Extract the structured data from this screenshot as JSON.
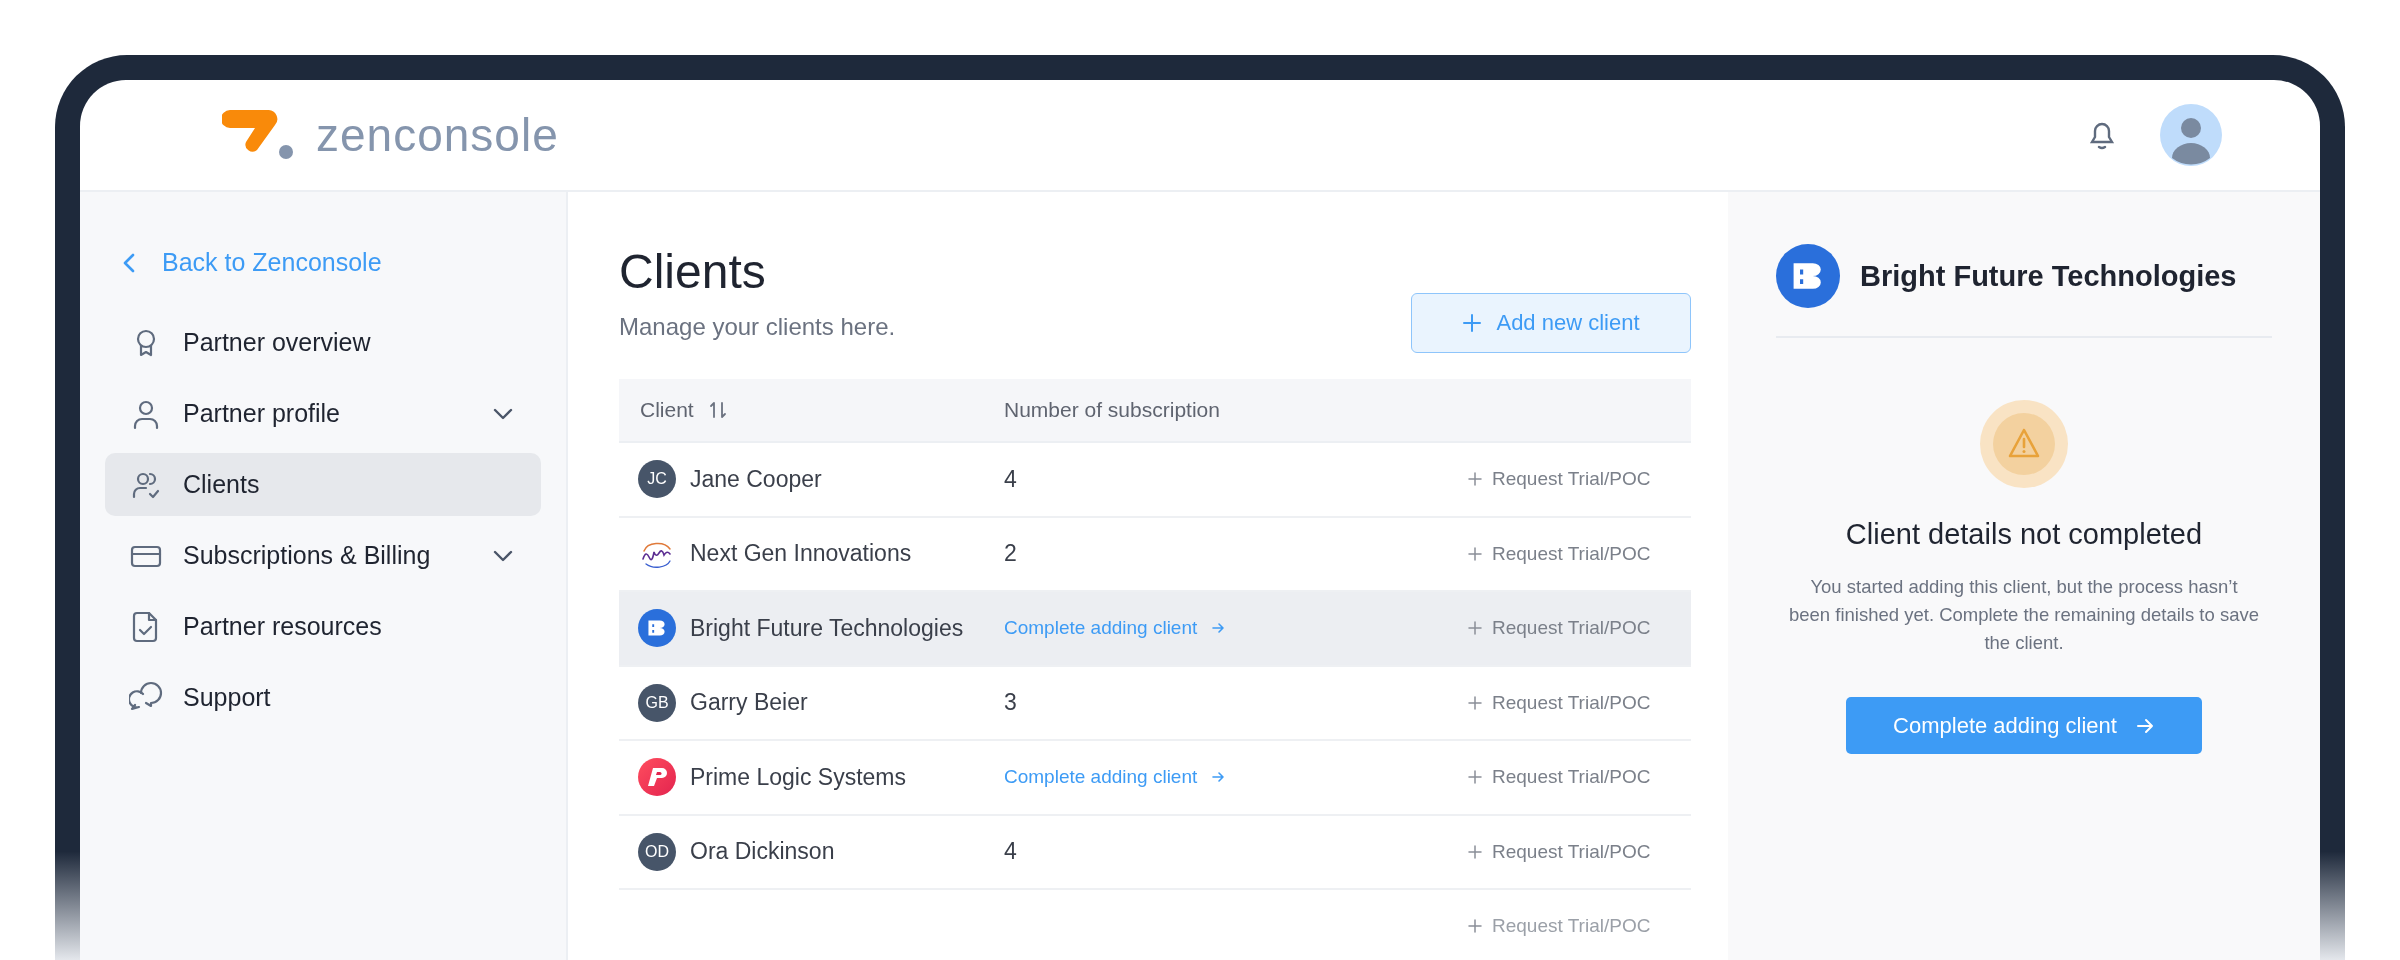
{
  "header": {
    "logo_text": "zenconsole"
  },
  "sidebar": {
    "back_link": "Back to Zenconsole",
    "items": [
      {
        "label": "Partner overview",
        "selected": false
      },
      {
        "label": "Partner profile",
        "selected": false,
        "expanded": false
      },
      {
        "label": "Clients",
        "selected": true
      },
      {
        "label": "Subscriptions & Billing",
        "selected": false,
        "expanded": false
      },
      {
        "label": "Partner resources",
        "selected": false
      },
      {
        "label": "Support",
        "selected": false
      }
    ]
  },
  "page": {
    "title": "Clients",
    "subtitle": "Manage your clients here.",
    "add_button": "Add new client"
  },
  "table": {
    "columns": [
      "Client",
      "Number of subscription"
    ],
    "rows": [
      {
        "avatar": {
          "kind": "initials",
          "text": "JC"
        },
        "client": "Jane Cooper",
        "kind": "count",
        "subscriptions": "4",
        "action": "Request Trial/POC",
        "selected": false
      },
      {
        "avatar": {
          "kind": "script"
        },
        "client": "Next Gen Innovations",
        "kind": "count",
        "subscriptions": "2",
        "action": "Request Trial/POC",
        "selected": false
      },
      {
        "avatar": {
          "kind": "blogo"
        },
        "client": "Bright Future Technologies",
        "kind": "incomplete",
        "subscriptions": "Complete adding client",
        "action": "Request Trial/POC",
        "selected": true
      },
      {
        "avatar": {
          "kind": "initials",
          "text": "GB"
        },
        "client": "Garry Beier",
        "kind": "count",
        "subscriptions": "3",
        "action": "Request Trial/POC",
        "selected": false
      },
      {
        "avatar": {
          "kind": "plogo"
        },
        "client": "Prime Logic Systems",
        "kind": "incomplete",
        "subscriptions": "Complete adding client",
        "action": "Request Trial/POC",
        "selected": false
      },
      {
        "avatar": {
          "kind": "initials",
          "text": "OD"
        },
        "client": "Ora Dickinson",
        "kind": "count",
        "subscriptions": "4",
        "action": "Request Trial/POC",
        "selected": false
      },
      {
        "kind": "partial",
        "action": "Request Trial/POC",
        "selected": false
      }
    ]
  },
  "detail": {
    "name": "Bright Future Technologies",
    "heading": "Client details not completed",
    "message": "You started adding this client, but the process hasn’t been finished yet. Complete the remaining details to save the client.",
    "button": "Complete adding client"
  }
}
